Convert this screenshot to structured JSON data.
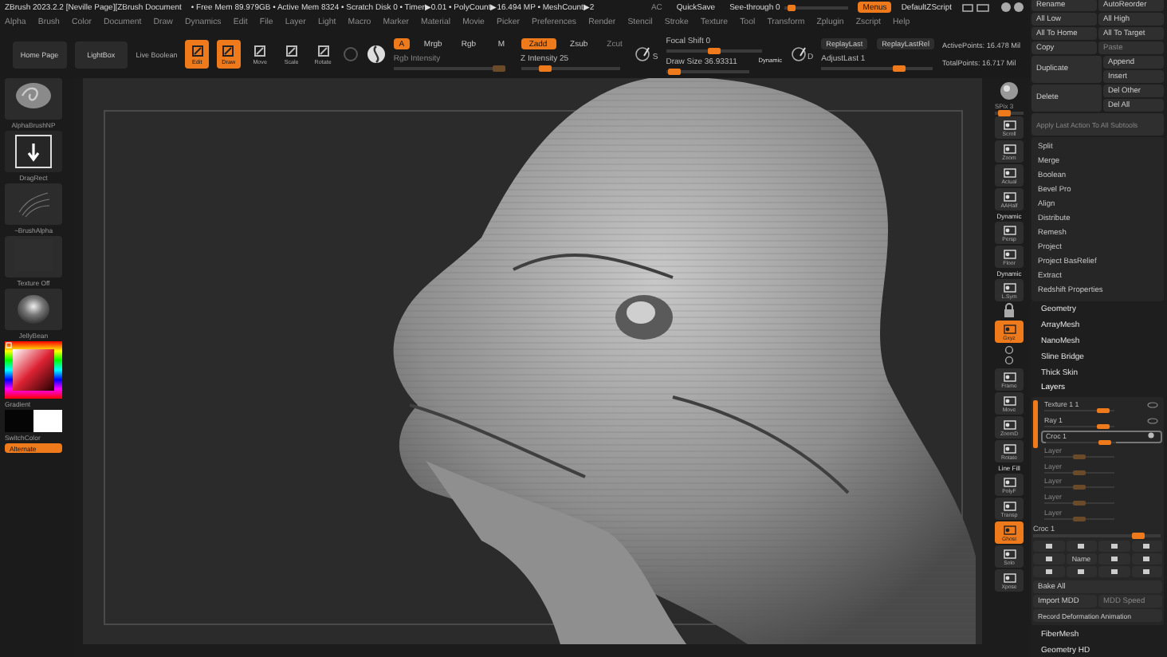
{
  "title_bar": {
    "title": "ZBrush 2023.2.2 [Neville Page][ZBrush Document",
    "stats": "• Free Mem 89.979GB • Active Mem 8324 • Scratch Disk 0 • Timer▶0.01 • PolyCount▶16.494 MP • MeshCount▶2",
    "ac": "AC",
    "quick_save": "QuickSave",
    "see_through": {
      "label": "See-through 0",
      "level": 0.05
    },
    "menus": {
      "label": "Menus",
      "on": true
    },
    "script": "DefaultZScript"
  },
  "menu_bar": [
    "Alpha",
    "Brush",
    "Color",
    "Document",
    "Draw",
    "Dynamics",
    "Edit",
    "File",
    "Layer",
    "Light",
    "Macro",
    "Marker",
    "Material",
    "Movie",
    "Picker",
    "Preferences",
    "Render",
    "Stencil",
    "Stroke",
    "Texture",
    "Tool",
    "Transform",
    "Zplugin",
    "Zscript",
    "Help"
  ],
  "toolbar": {
    "home_page": "Home Page",
    "lightbox": "LightBox",
    "live_boolean": "Live Boolean",
    "modes": [
      {
        "label": "Edit",
        "selected": true
      },
      {
        "label": "Draw",
        "selected": true
      },
      {
        "label": "Move",
        "selected": false
      },
      {
        "label": "Scale",
        "selected": false
      },
      {
        "label": "Rotate",
        "selected": false
      }
    ],
    "color_modes": [
      {
        "label": "A",
        "selected": true
      },
      {
        "label": "Mrgb",
        "selected": false
      },
      {
        "label": "Rgb",
        "selected": false
      },
      {
        "label": "M",
        "selected": false
      }
    ],
    "rgb_intensity": {
      "label": "Rgb Intensity",
      "level": 0.95,
      "disabled": true
    },
    "depth_modes": [
      {
        "label": "Zadd",
        "selected": true,
        "disabled": false
      },
      {
        "label": "Zsub",
        "selected": false,
        "disabled": false
      },
      {
        "label": "Zcut",
        "selected": false,
        "disabled": true
      }
    ],
    "z_intensity": {
      "label": "Z Intensity 25",
      "level": 0.25
    },
    "stroke_letter": "S",
    "focal_shift": {
      "label": "Focal Shift 0",
      "level": 0.5
    },
    "draw_size": {
      "label": "Draw Size 36.93311",
      "level": 0.1
    },
    "dynamic": "Dynamic",
    "brush_letter": "D",
    "replay_last": "ReplayLast",
    "replay_last_rel": "ReplayLastRel",
    "adjust_last": {
      "label": "AdjustLast 1",
      "level": 0.7
    },
    "active_points": "ActivePoints: 16.478 Mil",
    "total_points": "TotalPoints: 16.717 Mil"
  },
  "left_shelf": {
    "items": [
      {
        "label": "AlphaBrushNP",
        "kind": "brush"
      },
      {
        "label": "DragRect",
        "kind": "stroke"
      },
      {
        "label": "~BrushAlpha",
        "kind": "alpha"
      },
      {
        "label": "Texture Off",
        "kind": "texture"
      },
      {
        "label": "JellyBean",
        "kind": "material"
      }
    ],
    "gradient": "Gradient",
    "switch_color": "SwitchColor",
    "alternate": {
      "label": "Alternate",
      "on": true
    }
  },
  "right_shelf": [
    {
      "kind": "ball"
    },
    {
      "kind": "slider",
      "label": "SPix 3",
      "level": 0.35
    },
    {
      "kind": "button",
      "label": "Scroll",
      "selected": false
    },
    {
      "kind": "button",
      "label": "Zoom",
      "selected": false
    },
    {
      "kind": "button",
      "label": "Actual",
      "selected": false
    },
    {
      "kind": "button",
      "label": "AAHalf",
      "selected": false
    },
    {
      "kind": "button",
      "label": "Persp",
      "note": "Dynamic",
      "selected": false
    },
    {
      "kind": "button",
      "label": "Floor",
      "selected": false
    },
    {
      "kind": "button",
      "label": "L.Sym",
      "note": "Dynamic",
      "selected": false
    },
    {
      "kind": "lock"
    },
    {
      "kind": "button",
      "label": "Gxyz",
      "selected": true
    },
    {
      "kind": "axes"
    },
    {
      "kind": "button",
      "label": "Frame",
      "selected": false
    },
    {
      "kind": "button",
      "label": "Move",
      "selected": false
    },
    {
      "kind": "button",
      "label": "ZoomD",
      "selected": false
    },
    {
      "kind": "button",
      "label": "Rotate",
      "selected": false
    },
    {
      "kind": "button",
      "label": "PolyF",
      "note": "Line Fill",
      "selected": false
    },
    {
      "kind": "button",
      "label": "Transp",
      "selected": false
    },
    {
      "kind": "button",
      "label": "Ghost",
      "selected": true
    },
    {
      "kind": "button",
      "label": "Solo",
      "selected": false
    },
    {
      "kind": "button",
      "label": "Xpose",
      "selected": false
    }
  ],
  "tool_panel": {
    "action_rows": [
      {
        "cells": [
          {
            "label": "Rename",
            "disabled": false
          },
          {
            "label": "AutoReorder",
            "disabled": false
          }
        ]
      },
      {
        "cells": [
          {
            "label": "All Low",
            "disabled": false
          },
          {
            "label": "All High",
            "disabled": false
          }
        ]
      },
      {
        "cells": [
          {
            "label": "All To Home",
            "disabled": false
          },
          {
            "label": "All To Target",
            "disabled": false
          }
        ]
      },
      {
        "cells": [
          {
            "label": "Copy",
            "disabled": false
          },
          {
            "label": "Paste",
            "disabled": true
          }
        ]
      },
      {
        "cells": [
          {
            "label": "Duplicate",
            "disabled": false
          },
          [
            {
              "label": "Append",
              "disabled": false
            },
            {
              "label": "Insert",
              "disabled": false
            }
          ]
        ]
      },
      {
        "cells": [
          {
            "label": "Delete",
            "disabled": false
          },
          [
            {
              "label": "Del Other",
              "disabled": false
            },
            {
              "label": "Del All",
              "disabled": false
            }
          ]
        ]
      },
      {
        "cells": [
          {
            "label": "Apply Last Action To All Subtools",
            "disabled": true
          }
        ]
      }
    ],
    "functions": [
      "Split",
      "Merge",
      "Boolean",
      "Bevel Pro",
      "Align",
      "Distribute",
      "Remesh",
      "Project",
      "Project BasRelief",
      "Extract",
      "Redshift Properties"
    ],
    "sections": [
      {
        "label": "Geometry",
        "expanded": false
      },
      {
        "label": "ArrayMesh",
        "expanded": false
      },
      {
        "label": "NanoMesh",
        "expanded": false
      },
      {
        "label": "Sline Bridge",
        "expanded": false
      },
      {
        "label": "Thick Skin",
        "expanded": false
      },
      {
        "label": "Layers",
        "expanded": true
      },
      {
        "label": "FiberMesh",
        "expanded": false
      },
      {
        "label": "Geometry HD",
        "expanded": false
      }
    ],
    "layers": {
      "items": [
        {
          "name": "Texture 1 1",
          "level": 0.85,
          "selected": false,
          "disabled": false
        },
        {
          "name": "Ray 1",
          "level": 0.85,
          "selected": false,
          "disabled": false
        },
        {
          "name": "Croc 1",
          "level": 0.85,
          "selected": true,
          "disabled": false
        },
        {
          "name": "Layer",
          "level": 0.5,
          "selected": false,
          "disabled": true
        },
        {
          "name": "Layer",
          "level": 0.5,
          "selected": false,
          "disabled": true
        },
        {
          "name": "Layer",
          "level": 0.5,
          "selected": false,
          "disabled": true
        },
        {
          "name": "Layer",
          "level": 0.5,
          "selected": false,
          "disabled": true
        },
        {
          "name": "Layer",
          "level": 0.5,
          "selected": false,
          "disabled": true
        }
      ],
      "active": {
        "label": "Croc 1",
        "level": 0.82
      },
      "name_button": "Name",
      "bake_all": "Bake All",
      "import_mdd": "Import MDD",
      "mdd_speed": {
        "label": "MDD Speed",
        "disabled": true
      },
      "record": "Record Deformation Animation"
    }
  }
}
